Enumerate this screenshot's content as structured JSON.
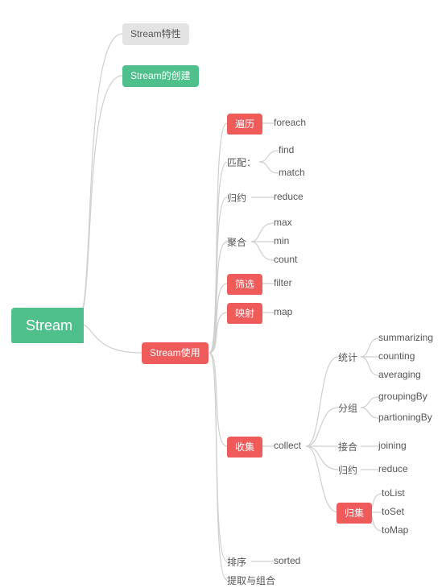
{
  "root": "Stream",
  "l1_features": "Stream特性",
  "l1_create": "Stream的创建",
  "l1_use": "Stream使用",
  "use": {
    "iterate": "遍历",
    "foreach": "foreach",
    "match_label": "匹配：",
    "find": "find",
    "match": "match",
    "reduce_label": "归约",
    "reduce": "reduce",
    "agg_label": "聚合",
    "max": "max",
    "min": "min",
    "count": "count",
    "filter_label": "筛选",
    "filter": "filter",
    "map_label": "映射",
    "map": "map",
    "collect_label": "收集",
    "collect": "collect",
    "sort_label": "排序",
    "sorted": "sorted",
    "extract_label": "提取与组合"
  },
  "collect": {
    "stat_label": "统计",
    "summarizing": "summarizing",
    "counting": "counting",
    "averaging": "averaging",
    "group_label": "分组",
    "groupingBy": "groupingBy",
    "partioningBy": "partioningBy",
    "join_label": "接合",
    "joining": "joining",
    "reduce_label": "归约",
    "reduce": "reduce",
    "toCollection_label": "归集",
    "toList": "toList",
    "toSet": "toSet",
    "toMap": "toMap"
  }
}
